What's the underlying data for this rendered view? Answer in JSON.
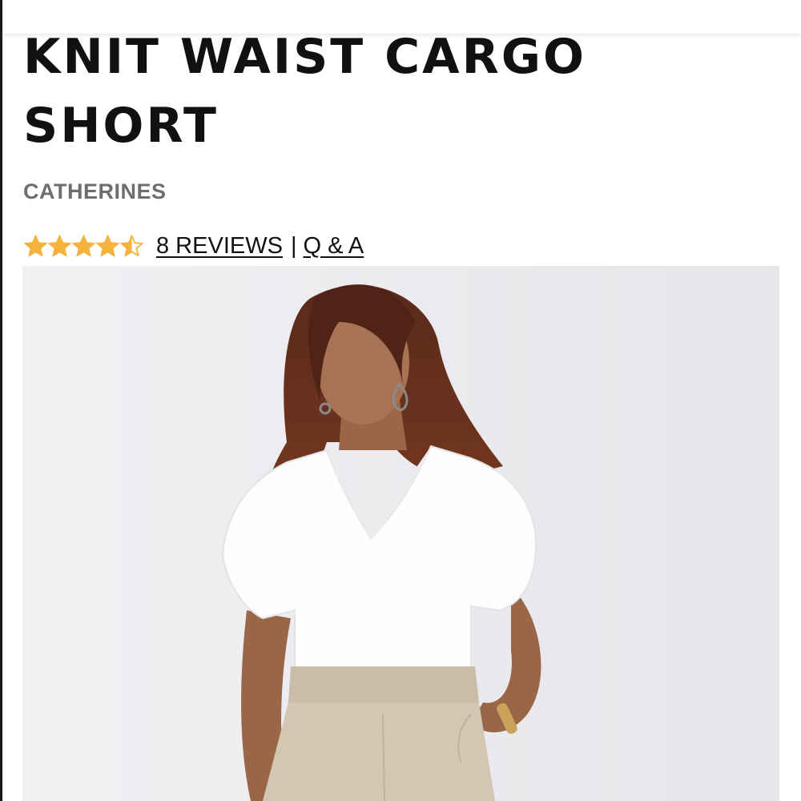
{
  "product": {
    "title": "KNIT WAIST CARGO SHORT",
    "brand": "CATHERINES",
    "rating": 4.5,
    "rating_max": 5,
    "reviews_label": "8 REVIEWS",
    "separator": "|",
    "qa_label": "Q & A",
    "image_alt": "Model wearing white v-neck tee and khaki knit waist cargo short"
  },
  "colors": {
    "star": "#f5b33d",
    "star_empty": "#f5b33d",
    "title": "#111111",
    "brand": "#6e6e6e",
    "image_bg": "#ecebee",
    "short_color": "#d3c6b3"
  },
  "icons": {
    "star_full": "star-full-icon",
    "star_half": "star-half-icon",
    "star_empty": "star-empty-icon"
  }
}
